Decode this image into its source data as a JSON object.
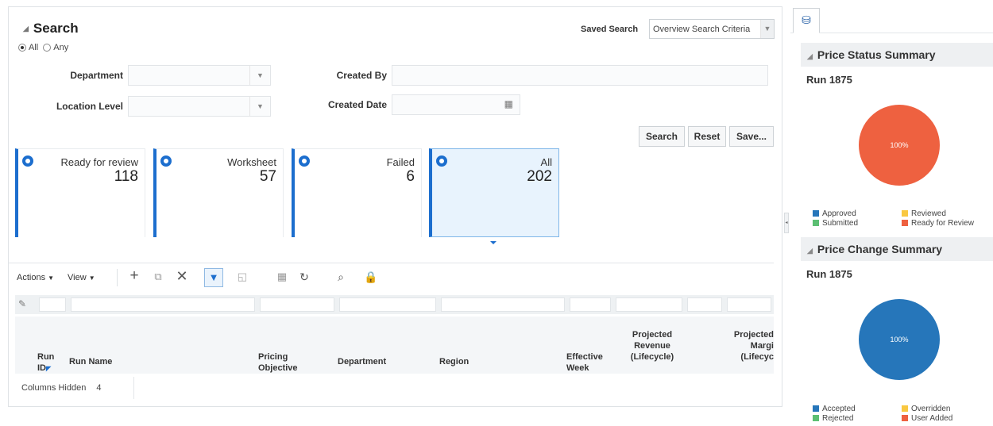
{
  "search": {
    "title": "Search",
    "match_all": "All",
    "match_any": "Any",
    "department_label": "Department",
    "location_level_label": "Location Level",
    "created_by_label": "Created By",
    "created_date_label": "Created Date",
    "saved_search_label": "Saved Search",
    "saved_search_value": "Overview Search Criteria",
    "search_button": "Search",
    "reset_button": "Reset",
    "save_button": "Save..."
  },
  "tiles": [
    {
      "label": "Ready for review",
      "count": "118"
    },
    {
      "label": "Worksheet",
      "count": "57"
    },
    {
      "label": "Failed",
      "count": "6"
    },
    {
      "label": "All",
      "count": "202"
    }
  ],
  "toolbar": {
    "actions": "Actions",
    "view": "View"
  },
  "table": {
    "headers": {
      "run_id": "Run ID",
      "run_name": "Run Name",
      "pricing_objective": "Pricing Objective",
      "department": "Department",
      "region": "Region",
      "effective_week": "Effective Week",
      "projected_revenue": "Projected Revenue (Lifecycle)",
      "projected_margin": "Projected Margi (Lifecyc"
    },
    "columns_hidden_label": "Columns Hidden",
    "columns_hidden_count": "4"
  },
  "price_status": {
    "title": "Price Status Summary",
    "run": "Run 1875",
    "pie_label": "100%",
    "legend": [
      "Approved",
      "Reviewed",
      "Submitted",
      "Ready for Review"
    ],
    "colors": [
      "#2676ba",
      "#f9c841",
      "#5cbf73",
      "#ee6140"
    ]
  },
  "price_change": {
    "title": "Price Change Summary",
    "run": "Run 1875",
    "pie_label": "100%",
    "legend": [
      "Accepted",
      "Overridden",
      "Rejected",
      "User Added"
    ],
    "colors": [
      "#2676ba",
      "#f9c841",
      "#5cbf73",
      "#ee6140"
    ]
  }
}
